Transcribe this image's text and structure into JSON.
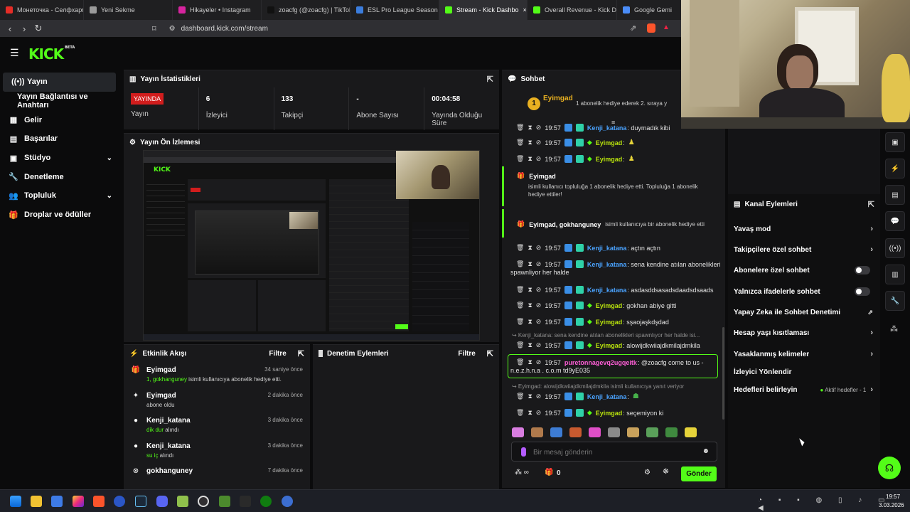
{
  "browser": {
    "tabs": [
      {
        "title": "Монеточка - Селфхарм (",
        "color": "#e52d27"
      },
      {
        "title": "Yeni Sekme",
        "color": "#9a9a9a"
      },
      {
        "title": "Hikayeler • Instagram",
        "color": "#d6249f"
      },
      {
        "title": "zoacfg (@zoacfg) | TikTok",
        "color": "#111111"
      },
      {
        "title": "ESL Pro League Season 23",
        "color": "#3b7ddd"
      },
      {
        "title": "Stream - Kick Dashbo",
        "color": "#53fc18",
        "active": true
      },
      {
        "title": "Overall Revenue - Kick Da",
        "color": "#53fc18"
      },
      {
        "title": "Google Gemi",
        "color": "#4a8cf7"
      }
    ],
    "url": "dashboard.kick.com/stream"
  },
  "app": {
    "logo": "KICK",
    "logo_sup": "BETA"
  },
  "sidebar": {
    "items": [
      {
        "label": "Yayın",
        "icon": "((•))"
      },
      {
        "label": "Yayın Bağlantısı ve Anahtarı",
        "icon": ""
      },
      {
        "label": "Gelir",
        "icon": "▦"
      },
      {
        "label": "Başarılar",
        "icon": "▤"
      },
      {
        "label": "Stüdyo",
        "icon": "▣",
        "chevron": "⌄"
      },
      {
        "label": "Denetleme",
        "icon": "🔧"
      },
      {
        "label": "Topluluk",
        "icon": "👥",
        "chevron": "⌄"
      },
      {
        "label": "Droplar ve ödüller",
        "icon": "🎁"
      }
    ]
  },
  "stats_panel": {
    "title": "Yayın İstatistikleri",
    "live_badge": "YAYINDA",
    "stats": [
      {
        "value": "",
        "label": "Yayın"
      },
      {
        "value": "6",
        "label": "İzleyici"
      },
      {
        "value": "133",
        "label": "Takipçi"
      },
      {
        "value": "-",
        "label": "Abone Sayısı"
      },
      {
        "value": "00:04:58",
        "label": "Yayında Olduğu Süre"
      }
    ]
  },
  "preview_panel": {
    "title": "Yayın Ön İzlemesi"
  },
  "activity_panel": {
    "title": "Etkinlik Akışı",
    "filter": "Filtre",
    "items": [
      {
        "name": "Eyimgad",
        "prefix": "1, ",
        "highlight": "gokhanguney",
        "desc": " isimli kullanıcıya abonelik hediye etti.",
        "time": "34 saniye önce",
        "icon": "🎁"
      },
      {
        "name": "Eyimgad",
        "prefix": "",
        "highlight": "",
        "desc": "abone oldu",
        "time": "2 dakika önce",
        "icon": "✦"
      },
      {
        "name": "Kenji_katana",
        "prefix": "",
        "highlight": "dik dur",
        "desc": " alındı",
        "time": "3 dakika önce",
        "icon": "●"
      },
      {
        "name": "Kenji_katana",
        "prefix": "",
        "highlight": "su iç",
        "desc": " alındı",
        "time": "3 dakika önce",
        "icon": "●"
      },
      {
        "name": "gokhanguney",
        "prefix": "",
        "highlight": "",
        "desc": "",
        "time": "7 dakika önce",
        "icon": "⊗"
      }
    ]
  },
  "moderation_panel": {
    "title": "Denetim Eylemleri",
    "filter": "Filtre"
  },
  "chat": {
    "title": "Sohbet",
    "pinned_user": "Eyimgad",
    "pinned_rank": "1",
    "pinned_text": "1 abonelik hediye ederek 2. sıraya y",
    "messages": [
      {
        "time": "19:57",
        "user": "Kenji_katana",
        "text": ": duymadık kibi",
        "color": "kenji"
      },
      {
        "time": "19:57",
        "user": "Eyimgad",
        "text": ":",
        "color": "eyi"
      },
      {
        "time": "19:57",
        "user": "Eyimgad",
        "text": ":",
        "color": "eyi"
      },
      {
        "time": "19:57",
        "user": "Kenji_katana",
        "text": ": açtın açtın",
        "color": "kenji"
      },
      {
        "time": "19:57",
        "user": "Kenji_katana",
        "text": ": sena kendine atılan abonelikleri",
        "text2": "spawnliyor her halde",
        "color": "kenji"
      },
      {
        "time": "19:57",
        "user": "Kenji_katana",
        "text": ": asdasddsasadsdaadsdsaads",
        "color": "kenji"
      },
      {
        "time": "19:57",
        "user": "Eyimgad",
        "text": ": gokhan abiye gitti",
        "color": "eyi"
      },
      {
        "time": "19:57",
        "user": "Eyimgad",
        "text": ": sşaojaşkdşdad",
        "color": "eyi"
      },
      {
        "time": "19:57",
        "user": "Eyimgad",
        "text": ": alowijdkwiiajdkmilajdmkila",
        "color": "eyi"
      },
      {
        "time": "19:57",
        "user": "puretonnagevq2ugqeitk",
        "text": ": @zoacfg come to us -",
        "text2": "n.e.z.h.n.a . c.o.m td9yE035",
        "color": "pur"
      },
      {
        "time": "19:57",
        "user": "Kenji_katana",
        "text": ":",
        "color": "kenji"
      },
      {
        "time": "19:57",
        "user": "Eyimgad",
        "text": ": seçemiyon ki",
        "color": "eyi"
      }
    ],
    "sys1": {
      "title": "Eyimgad",
      "desc": "isimli kullanıcı topluluğa 1 abonelik hediye etti. Topluluğa 1 abonelik hediye ettiler!"
    },
    "sys2": {
      "title": "Eyimgad, gokhanguney",
      "desc": " isimli kullanıcıya bir abonelik hediye etti"
    },
    "reply1": "↪ Kenji_katana: sena kendine atılan abonelikleri spawnlıyor her halde isi...",
    "reply2": "↪ Eyimgad: alowijdkwiiajdkmilajdmkila isimli kullanıcıya yanıt veriyor",
    "placeholder": "Bir mesaj gönderin",
    "send": "Gönder",
    "points": "0"
  },
  "channel_actions": {
    "title": "Kanal Eylemleri",
    "items": [
      {
        "label": "Yavaş mod",
        "control": "chevron"
      },
      {
        "label": "Takipçilere özel sohbet",
        "control": "chevron"
      },
      {
        "label": "Abonelere özel sohbet",
        "control": "toggle"
      },
      {
        "label": "Yalnızca ifadelerle sohbet",
        "control": "toggle"
      },
      {
        "label": "Yapay Zeka ile Sohbet Denetimi",
        "control": "external"
      },
      {
        "label": "Hesap yaşı kısıtlaması",
        "control": "chevron"
      },
      {
        "label": "Yasaklanmış kelimeler",
        "control": "chevron"
      },
      {
        "label": "İzleyici Yönlendir",
        "control": "none"
      },
      {
        "label": "Hedefleri belirleyin",
        "control": "chevron",
        "extra": "Aktif hedefler - 1"
      }
    ]
  },
  "taskbar": {
    "time": "19:57",
    "date": "3.03.2026"
  },
  "colors": {
    "accent": "#53fc18",
    "live": "#d11d1d",
    "panel": "#19191b"
  }
}
